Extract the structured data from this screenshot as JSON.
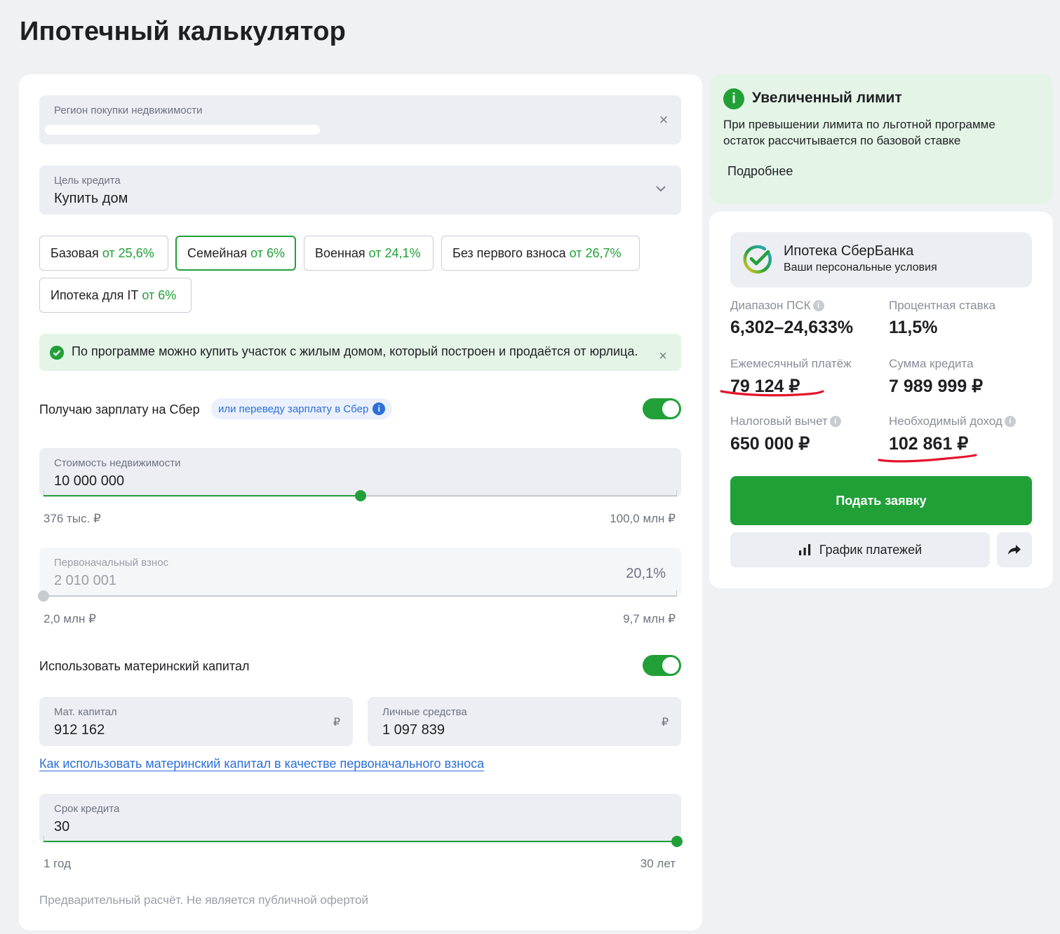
{
  "page_title": "Ипотечный калькулятор",
  "region": {
    "label": "Регион покупки недвижимости",
    "value": "",
    "clear_icon": "close-icon"
  },
  "goal": {
    "label": "Цель кредита",
    "value": "Купить дом",
    "icon": "chevron-down-icon"
  },
  "programs": [
    {
      "name": "Базовая",
      "rate": "от 25,6%",
      "active": false
    },
    {
      "name": "Семейная",
      "rate": "от 6%",
      "active": true
    },
    {
      "name": "Военная",
      "rate": "от 24,1%",
      "active": false
    },
    {
      "name": "Без первого взноса",
      "rate": "от 26,7%",
      "active": false
    },
    {
      "name": "Ипотека для IT",
      "rate": "от 6%",
      "active": false
    }
  ],
  "info_banner": {
    "text": "По программе можно купить участок с жилым домом, который построен и продаётся от юрлица.",
    "icon": "check-circle-icon"
  },
  "salary": {
    "label": "Получаю зарплату на Сбер",
    "pill": "или переведу зарплату в Сбер",
    "toggle_on": true
  },
  "property_price": {
    "label": "Стоимость недвижимости",
    "value": "10 000 000",
    "min_label": "376 тыс. ₽",
    "max_label": "100,0 млн ₽",
    "slider_fraction": 0.5
  },
  "down_payment": {
    "label": "Первоначальный взнос",
    "value": "2 010 001",
    "percent": "20,1%",
    "min_label": "2,0 млн ₽",
    "max_label": "9,7 млн ₽",
    "slider_fraction": 0.0
  },
  "maternal": {
    "label": "Использовать материнский капитал",
    "toggle_on": true,
    "capital_label": "Мат. капитал",
    "capital_value": "912 162",
    "own_label": "Личные средства",
    "own_value": "1 097 839",
    "currency": "₽",
    "link": "Как использовать материнский капитал в качестве первоначального взноса"
  },
  "term": {
    "label": "Срок кредита",
    "value": "30",
    "min_label": "1 год",
    "max_label": "30 лет",
    "slider_fraction": 1.0
  },
  "disclaimer": "Предварительный расчёт. Не является публичной офертой",
  "limit": {
    "title": "Увеличенный лимит",
    "text": "При превышении лимита по льготной программе остаток рассчитывается по базовой ставке",
    "more": "Подробнее"
  },
  "offer": {
    "title": "Ипотека СберБанка",
    "subtitle": "Ваши персональные условия",
    "psk_label": "Диапазон ПСК",
    "psk_value": "6,302–24,633%",
    "rate_label": "Процентная ставка",
    "rate_value": "11,5%",
    "monthly_label": "Ежемесячный платёж",
    "monthly_value": "79 124 ₽",
    "loan_label": "Сумма кредита",
    "loan_value": "7 989 999 ₽",
    "tax_label": "Налоговый вычет",
    "tax_value": "650 000 ₽",
    "income_label": "Необходимый доход",
    "income_value": "102 861 ₽",
    "apply_button": "Подать заявку",
    "schedule_button": "График платежей"
  },
  "colors": {
    "accent": "#21a038",
    "link": "#2b6fd9",
    "annotation": "#e3142a"
  }
}
